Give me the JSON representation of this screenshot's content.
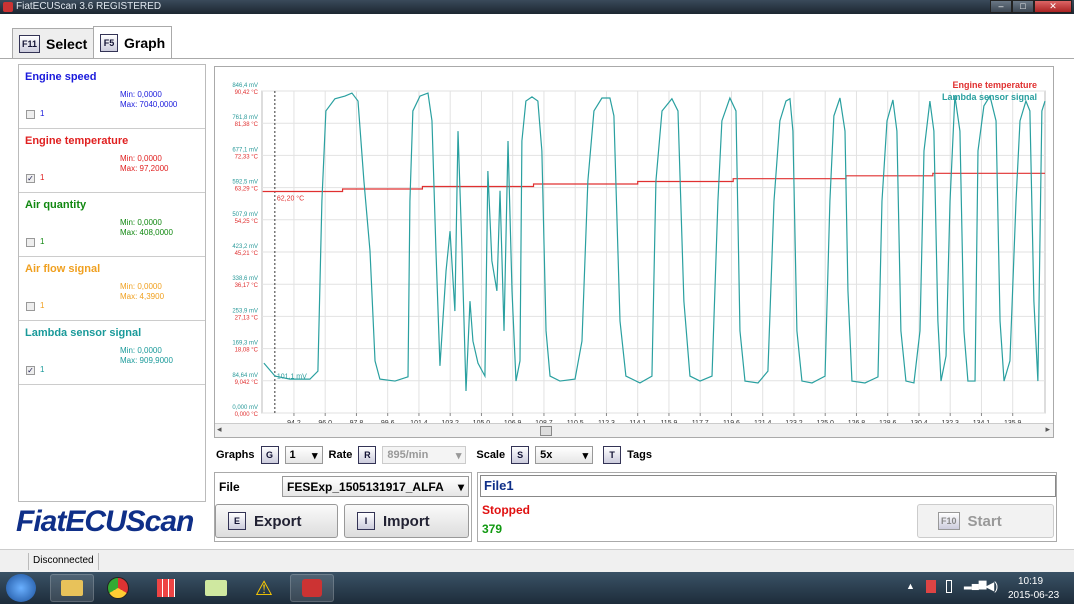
{
  "window": {
    "title": "FiatECUScan 3.6 REGISTERED"
  },
  "tabs": [
    {
      "key": "F11",
      "label": "Select"
    },
    {
      "key": "F5",
      "label": "Graph"
    }
  ],
  "signals": [
    {
      "name": "Engine speed",
      "min": "Min: 0,0000",
      "max": "Max: 7040,0000",
      "checked": false,
      "graph": "1",
      "color": "#1a1adc"
    },
    {
      "name": "Engine temperature",
      "min": "Min: 0,0000",
      "max": "Max: 97,2000",
      "checked": true,
      "graph": "1",
      "color": "#e02020"
    },
    {
      "name": "Air quantity",
      "min": "Min: 0,0000",
      "max": "Max: 408,0000",
      "checked": false,
      "graph": "1",
      "color": "#118811"
    },
    {
      "name": "Air flow signal",
      "min": "Min: 0,0000",
      "max": "Max: 4,3900",
      "checked": false,
      "graph": "1",
      "color": "#f0a020"
    },
    {
      "name": "Lambda sensor signal",
      "min": "Min: 0,0000",
      "max": "Max: 909,9000",
      "checked": true,
      "graph": "1",
      "color": "#1a9a9a"
    }
  ],
  "logo": "FiatECUScan",
  "chart_data": {
    "type": "line",
    "xlim": [
      92.36,
      137.46
    ],
    "x_ticks": [
      "94,2",
      "96,0",
      "97,8",
      "99,6",
      "101,4",
      "103,2",
      "105,0",
      "106,9",
      "108,7",
      "110,5",
      "112,3",
      "114,1",
      "115,9",
      "117,7",
      "119,6",
      "121,4",
      "123,2",
      "125,0",
      "126,8",
      "128,6",
      "130,4",
      "132,3",
      "134,1",
      "135,9"
    ],
    "y_ticks_mv": [
      "0,000 mV",
      "84,64 mV",
      "169,3 mV",
      "253,9 mV",
      "338,6 mV",
      "423,2 mV",
      "507,9 mV",
      "592,5 mV",
      "677,1 mV",
      "761,8 mV",
      "846,4 mV"
    ],
    "y_ticks_c": [
      "0,000 °C",
      "9,042 °C",
      "18,08 °C",
      "27,13 °C",
      "36,17 °C",
      "45,21 °C",
      "54,25 °C",
      "63,29 °C",
      "72,33 °C",
      "81,38 °C",
      "90,42 °C"
    ],
    "ylim_mv": [
      0,
      846.4
    ],
    "ylim_c": [
      0,
      90.42
    ],
    "grid": true,
    "legend": "top-right",
    "cursor_x": 93.1,
    "cursor_labels": {
      "temp": "62,20 °C",
      "lambda": "101,1 mV"
    },
    "series": [
      {
        "name": "Engine temperature",
        "color": "#e03030",
        "unit": "C",
        "points": [
          [
            92.4,
            62.2
          ],
          [
            97.0,
            62.2
          ],
          [
            97.0,
            62.9
          ],
          [
            101.6,
            62.9
          ],
          [
            101.6,
            63.6
          ],
          [
            108,
            63.6
          ],
          [
            108,
            64.3
          ],
          [
            114,
            64.3
          ],
          [
            114,
            65.0
          ],
          [
            119.5,
            65.0
          ],
          [
            119.5,
            65.8
          ],
          [
            126,
            65.8
          ],
          [
            126,
            66.6
          ],
          [
            131,
            66.6
          ],
          [
            131,
            67.3
          ],
          [
            137.46,
            67.3
          ]
        ]
      },
      {
        "name": "Lambda sensor signal",
        "color": "#2aa0a0",
        "unit": "mV",
        "points": [
          [
            92.47,
            131
          ],
          [
            93.11,
            97
          ],
          [
            93.97,
            89
          ],
          [
            95.12,
            89
          ],
          [
            95.58,
            110
          ],
          [
            95.81,
            557
          ],
          [
            96.04,
            794
          ],
          [
            96.56,
            826
          ],
          [
            97.14,
            833
          ],
          [
            97.54,
            841
          ],
          [
            97.89,
            820
          ],
          [
            98.23,
            610
          ],
          [
            98.58,
            426
          ],
          [
            98.87,
            137
          ],
          [
            99.15,
            89
          ],
          [
            100.02,
            84
          ],
          [
            100.77,
            95
          ],
          [
            100.88,
            557
          ],
          [
            101.05,
            794
          ],
          [
            101.46,
            833
          ],
          [
            101.92,
            841
          ],
          [
            102.15,
            768
          ],
          [
            102.38,
            426
          ],
          [
            102.61,
            124
          ],
          [
            102.72,
            202
          ],
          [
            102.96,
            373
          ],
          [
            103.19,
            478
          ],
          [
            103.47,
            268
          ],
          [
            103.65,
            741
          ],
          [
            103.88,
            426
          ],
          [
            104.11,
            58
          ],
          [
            104.34,
            294
          ],
          [
            104.51,
            189
          ],
          [
            104.8,
            131
          ],
          [
            105.2,
            97
          ],
          [
            105.37,
            636
          ],
          [
            105.6,
            400
          ],
          [
            105.89,
            321
          ],
          [
            106.07,
            584
          ],
          [
            106.3,
            216
          ],
          [
            106.53,
            715
          ],
          [
            106.76,
            321
          ],
          [
            106.99,
            84
          ],
          [
            107.22,
            137
          ],
          [
            107.33,
            715
          ],
          [
            107.56,
            820
          ],
          [
            107.91,
            831
          ],
          [
            108.25,
            820
          ],
          [
            108.48,
            689
          ],
          [
            108.72,
            216
          ],
          [
            108.95,
            97
          ],
          [
            109.52,
            84
          ],
          [
            110.39,
            89
          ],
          [
            110.79,
            189
          ],
          [
            111.13,
            610
          ],
          [
            111.48,
            794
          ],
          [
            111.94,
            828
          ],
          [
            112.4,
            828
          ],
          [
            112.63,
            781
          ],
          [
            112.98,
            242
          ],
          [
            113.32,
            97
          ],
          [
            114.13,
            79
          ],
          [
            114.82,
            97
          ],
          [
            115.05,
            610
          ],
          [
            115.4,
            794
          ],
          [
            115.97,
            826
          ],
          [
            116.32,
            794
          ],
          [
            116.66,
            294
          ],
          [
            117.01,
            97
          ],
          [
            117.59,
            84
          ],
          [
            118.28,
            97
          ],
          [
            118.62,
            557
          ],
          [
            118.85,
            768
          ],
          [
            119.31,
            828
          ],
          [
            119.66,
            794
          ],
          [
            119.89,
            216
          ],
          [
            120.18,
            84
          ],
          [
            120.93,
            79
          ],
          [
            121.5,
            110
          ],
          [
            121.85,
            557
          ],
          [
            122.19,
            768
          ],
          [
            122.54,
            820
          ],
          [
            122.77,
            826
          ],
          [
            122.94,
            741
          ],
          [
            123.17,
            216
          ],
          [
            123.46,
            84
          ],
          [
            124.04,
            79
          ],
          [
            124.79,
            97
          ],
          [
            125.07,
            557
          ],
          [
            125.3,
            781
          ],
          [
            125.65,
            828
          ],
          [
            125.94,
            741
          ],
          [
            126.11,
            321
          ],
          [
            126.34,
            84
          ],
          [
            127.09,
            79
          ],
          [
            127.84,
            95
          ],
          [
            128.07,
            557
          ],
          [
            128.36,
            768
          ],
          [
            128.7,
            823
          ],
          [
            128.93,
            741
          ],
          [
            129.16,
            216
          ],
          [
            129.45,
            84
          ],
          [
            129.91,
            79
          ],
          [
            130.26,
            216
          ],
          [
            130.49,
            689
          ],
          [
            130.83,
            820
          ],
          [
            131.06,
            741
          ],
          [
            131.29,
            242
          ],
          [
            131.47,
            84
          ],
          [
            131.76,
            150
          ],
          [
            131.99,
            557
          ],
          [
            132.27,
            833
          ],
          [
            132.56,
            741
          ],
          [
            132.79,
            216
          ],
          [
            133.02,
            84
          ],
          [
            133.43,
            84
          ],
          [
            133.6,
            689
          ],
          [
            133.94,
            807
          ],
          [
            134.29,
            833
          ],
          [
            134.64,
            768
          ],
          [
            134.87,
            242
          ],
          [
            135.1,
            84
          ],
          [
            135.44,
            137
          ],
          [
            135.79,
            557
          ],
          [
            136.02,
            768
          ],
          [
            136.36,
            820
          ],
          [
            136.59,
            794
          ],
          [
            136.82,
            294
          ],
          [
            137.05,
            84
          ],
          [
            137.28,
            794
          ],
          [
            137.46,
            820
          ]
        ]
      }
    ]
  },
  "controls": {
    "graphs_label": "Graphs",
    "graphs_key": "G",
    "graphs_value": "1",
    "rate_label": "Rate",
    "rate_key": "R",
    "rate_value": "895/min",
    "scale_label": "Scale",
    "scale_key": "S",
    "scale_value": "5x",
    "tags_key": "T",
    "tags_label": "Tags"
  },
  "file": {
    "label": "File",
    "value": "FESExp_1505131917_ALFA",
    "export_key": "E",
    "export_label": "Export",
    "import_key": "I",
    "import_label": "Import"
  },
  "run": {
    "filename": "File1",
    "status": "Stopped",
    "count": "379",
    "start_key": "F10",
    "start_label": "Start"
  },
  "statusbar": {
    "connection": "Disconnected"
  },
  "taskbar": {
    "time": "10:19",
    "date": "2015-06-23"
  }
}
